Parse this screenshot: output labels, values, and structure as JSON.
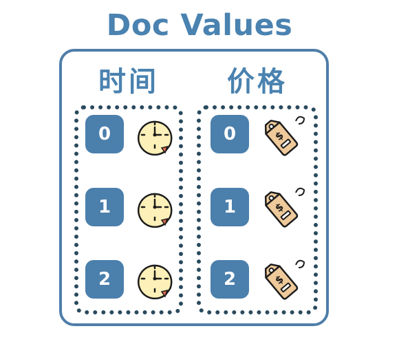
{
  "title": "Doc Values",
  "columns": [
    {
      "header": "时间",
      "rows": [
        {
          "index": "0",
          "icon": "clock-icon"
        },
        {
          "index": "1",
          "icon": "clock-icon"
        },
        {
          "index": "2",
          "icon": "clock-icon"
        }
      ]
    },
    {
      "header": "价格",
      "rows": [
        {
          "index": "0",
          "icon": "price-tag-icon"
        },
        {
          "index": "1",
          "icon": "price-tag-icon"
        },
        {
          "index": "2",
          "icon": "price-tag-icon"
        }
      ]
    }
  ],
  "colors": {
    "accent": "#4a82b0",
    "border": "#4f7ea9",
    "dotted": "#2a4a5e",
    "box": "#4b7fac",
    "clock_face": "#fdf0b8",
    "tag_fill": "#eec99a",
    "arrow": "#e36a4f",
    "stroke": "#1c1c1c"
  }
}
